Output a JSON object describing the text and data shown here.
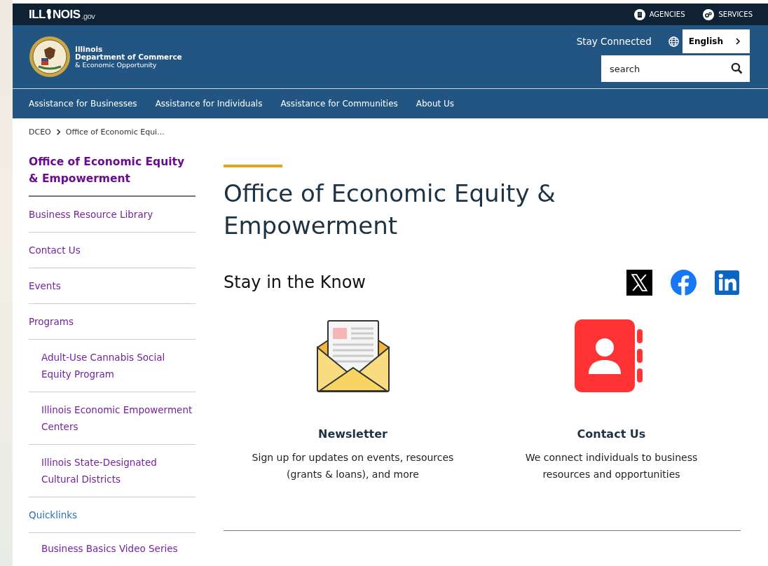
{
  "top_bar": {
    "logo_start": "ILL",
    "logo_end": "NOIS",
    "logo_suffix": ".gov",
    "links": [
      {
        "label": "AGENCIES",
        "kind": "building"
      },
      {
        "label": "SERVICES",
        "kind": "gears"
      }
    ]
  },
  "header": {
    "org_line1": "Illinois",
    "org_line2": "Department of Commerce",
    "org_line3": "& Economic Opportunity",
    "stay_connected": "Stay Connected",
    "language": "English",
    "search": {
      "placeholder": "search"
    }
  },
  "nav": [
    "Assistance for Businesses",
    "Assistance for Individuals",
    "Assistance for Communities",
    "About Us"
  ],
  "breadcrumb": [
    "DCEO",
    "Office of Economic Equi..."
  ],
  "sidebar": {
    "title": "Office of Economic Equity & Empowerment",
    "items": [
      {
        "label": "Business Resource Library",
        "visited": true
      },
      {
        "label": "Contact Us",
        "visited": true
      },
      {
        "label": "Events",
        "visited": true
      },
      {
        "label": "Programs",
        "visited": true,
        "children": [
          {
            "label": "Adult-Use Cannabis Social Equity Program",
            "visited": true
          },
          {
            "label": "Illinois Economic Empowerment Centers",
            "visited": true
          },
          {
            "label": "Illinois State-Designated Cultural Districts",
            "visited": true
          }
        ]
      },
      {
        "label": "Quicklinks",
        "visited": false,
        "children": [
          {
            "label": "Business Basics Video Series",
            "visited": true
          }
        ]
      }
    ]
  },
  "main": {
    "title": "Office of Economic Equity & Empowerment",
    "section_title": "Stay in the Know",
    "social": [
      {
        "kind": "x"
      },
      {
        "kind": "facebook"
      },
      {
        "kind": "linkedin"
      }
    ],
    "cards": [
      {
        "kind": "newsletter",
        "title": "Newsletter",
        "text": "Sign up for updates on events, resources (grants & loans), and more"
      },
      {
        "kind": "contact",
        "title": "Contact Us",
        "text": "We connect individuals to business resources and opportunities"
      }
    ]
  }
}
